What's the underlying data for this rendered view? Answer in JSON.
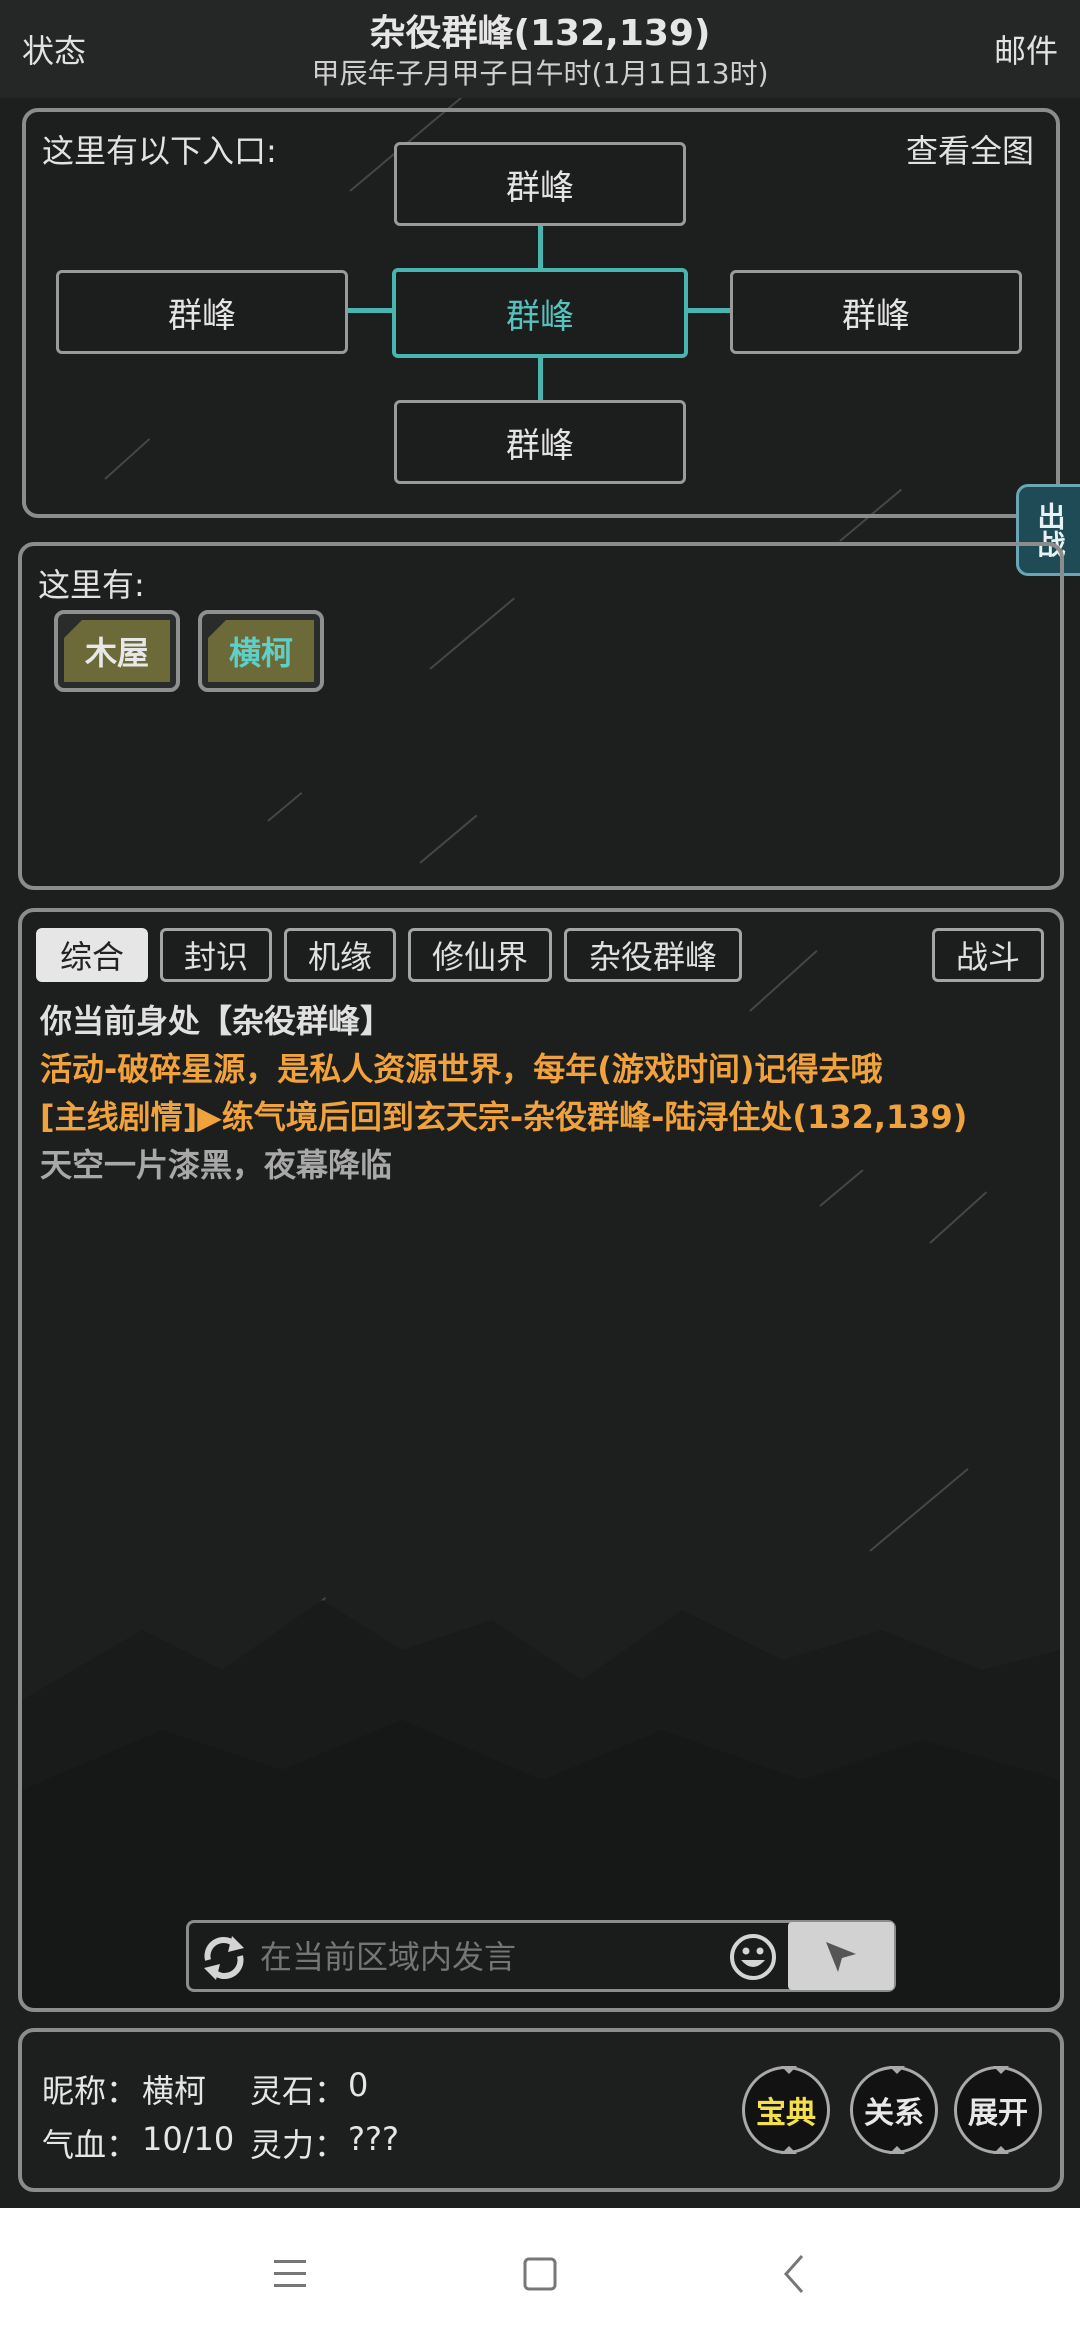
{
  "header": {
    "left_label": "状态",
    "title": "杂役群峰(132,139)",
    "subtitle": "甲辰年子月甲子日午时(1月1日13时)",
    "right_label": "邮件"
  },
  "entrances": {
    "heading": "这里有以下入口:",
    "view_full_map": "查看全图",
    "north": "群峰",
    "west": "群峰",
    "center": "群峰",
    "east": "群峰",
    "south": "群峰"
  },
  "side_button": "出战",
  "here": {
    "heading": "这里有:",
    "items": [
      {
        "label": "木屋",
        "color": "#e8e8e8"
      },
      {
        "label": "横柯",
        "color": "#5fd0c8"
      }
    ]
  },
  "tabs": {
    "items": [
      "综合",
      "封识",
      "机缘",
      "修仙界",
      "杂役群峰"
    ],
    "battle": "战斗",
    "active": "综合"
  },
  "messages": [
    {
      "text": "你当前身处【杂役群峰】",
      "color": "#e0e0e0"
    },
    {
      "text": "活动-破碎星源，是私人资源世界，每年(游戏时间)记得去哦",
      "color": "#f0a23c"
    },
    {
      "text": "[主线剧情]▶练气境后回到玄天宗-杂役群峰-陆浔住处(132,139)",
      "color": "#f0a23c"
    },
    {
      "text": "天空一片漆黑，夜幕降临",
      "color": "#a8a8a8"
    }
  ],
  "chat": {
    "placeholder": "在当前区域内发言"
  },
  "status": {
    "nickname_label": "昵称：",
    "nickname": "横柯",
    "spirit_stone_label": "灵石：",
    "spirit_stone": "0",
    "hp_label": "气血：",
    "hp": "10/10",
    "mana_label": "灵力：",
    "mana": "???"
  },
  "buttons": {
    "treasure": "宝典",
    "relations": "关系",
    "expand": "展开",
    "treasure_color": "#f4e04a"
  },
  "icons": {
    "refresh": "refresh-icon",
    "emoji": "smiley-icon",
    "send": "cursor-arrow-icon",
    "nav_menu": "menu-icon",
    "nav_home": "home-square-icon",
    "nav_back": "back-chevron-icon"
  }
}
